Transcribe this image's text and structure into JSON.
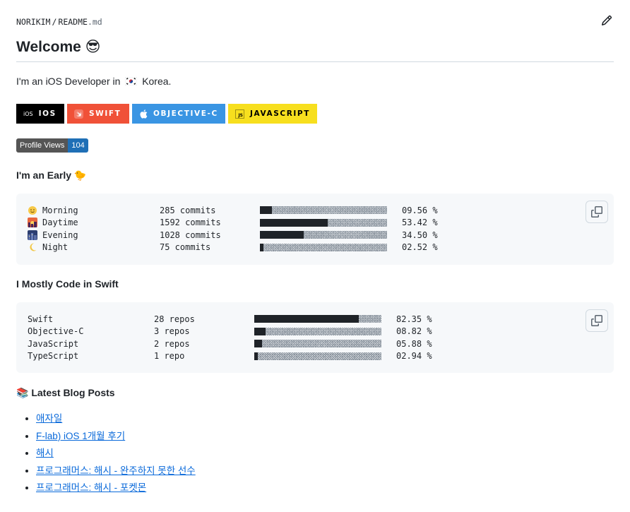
{
  "header": {
    "owner": "NORIKIM",
    "separator": "/",
    "file_base": "README",
    "file_ext": ".md",
    "edit_icon": "pencil-icon"
  },
  "title": "Welcome 😎",
  "intro": {
    "before": "I'm an iOS Developer in",
    "flag_icon": "korea-flag-icon",
    "after": "Korea."
  },
  "badges": [
    {
      "label": "IOS",
      "icon_text": "iOS",
      "icon": "ios-icon",
      "color": "#000000"
    },
    {
      "label": "SWIFT",
      "icon": "swift-icon",
      "color": "#f05138"
    },
    {
      "label": "OBJECTIVE-C",
      "icon": "apple-icon",
      "color": "#3a95e3"
    },
    {
      "label": "JAVASCRIPT",
      "icon_text": "JS",
      "icon": "javascript-icon",
      "color": "#f7df1e",
      "text_color": "#000000"
    }
  ],
  "profile_views": {
    "label": "Profile Views",
    "count": "104"
  },
  "early": {
    "heading": "I'm an Early 🐤",
    "rows": [
      {
        "icon": "sun-face-icon",
        "label": "Morning",
        "commits": "285 commits",
        "fraction": 0.0956,
        "percent": "09.56 %"
      },
      {
        "icon": "city-sunset-icon",
        "label": "Daytime",
        "commits": "1592 commits",
        "fraction": 0.5342,
        "percent": "53.42 %"
      },
      {
        "icon": "night-city-icon",
        "label": "Evening",
        "commits": "1028 commits",
        "fraction": 0.345,
        "percent": "34.50 %"
      },
      {
        "icon": "crescent-moon-icon",
        "label": "Night",
        "commits": "75 commits",
        "fraction": 0.0252,
        "percent": "02.52 %"
      }
    ]
  },
  "languages": {
    "heading": "I Mostly Code in Swift",
    "rows": [
      {
        "label": "Swift",
        "repos": "28 repos",
        "fraction": 0.8235,
        "percent": "82.35 %"
      },
      {
        "label": "Objective-C",
        "repos": "3 repos",
        "fraction": 0.0882,
        "percent": "08.82 %"
      },
      {
        "label": "JavaScript",
        "repos": "2 repos",
        "fraction": 0.0588,
        "percent": "05.88 %"
      },
      {
        "label": "TypeScript",
        "repos": "1 repo",
        "fraction": 0.0294,
        "percent": "02.94 %"
      }
    ]
  },
  "blog": {
    "heading": "📚 Latest Blog Posts",
    "posts": [
      "애자일",
      "F-lab) iOS 1개월 후기",
      "해시",
      "프로그래머스: 해시 - 완주하지 못한 선수",
      "프로그래머스: 해시 - 포켓몬"
    ]
  },
  "copy_icon": "copy-icon"
}
